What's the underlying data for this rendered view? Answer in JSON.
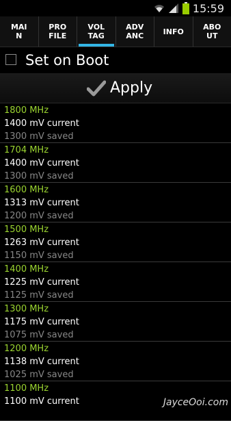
{
  "status_bar": {
    "time": "15:59"
  },
  "tabs": [
    {
      "label": "MAI\nN",
      "active": false
    },
    {
      "label": "PRO\nFILE",
      "active": false
    },
    {
      "label": "VOL\nTAG",
      "active": true
    },
    {
      "label": "ADV\nANC",
      "active": false
    },
    {
      "label": "INFO",
      "active": false
    },
    {
      "label": "ABO\nUT",
      "active": false
    }
  ],
  "set_on_boot": {
    "label": "Set on Boot",
    "checked": false
  },
  "apply": {
    "label": "Apply"
  },
  "voltages": [
    {
      "freq": "1800 MHz",
      "current": "1400 mV current",
      "saved": "1300 mV saved"
    },
    {
      "freq": "1704 MHz",
      "current": "1400 mV current",
      "saved": "1300 mV saved"
    },
    {
      "freq": "1600 MHz",
      "current": "1313 mV current",
      "saved": "1200 mV saved"
    },
    {
      "freq": "1500 MHz",
      "current": "1263 mV current",
      "saved": "1150 mV saved"
    },
    {
      "freq": "1400 MHz",
      "current": "1225 mV current",
      "saved": "1125 mV saved"
    },
    {
      "freq": "1300 MHz",
      "current": "1175 mV current",
      "saved": "1075 mV saved"
    },
    {
      "freq": "1200 MHz",
      "current": "1138 mV current",
      "saved": "1025 mV saved"
    },
    {
      "freq": "1100 MHz",
      "current": "1100 mV current",
      "saved": ""
    }
  ],
  "watermark": "JayceOoi.com",
  "colors": {
    "accent": "#33b5e5",
    "frequency": "#9bd530",
    "saved": "#888888",
    "battery": "#99cc00"
  }
}
